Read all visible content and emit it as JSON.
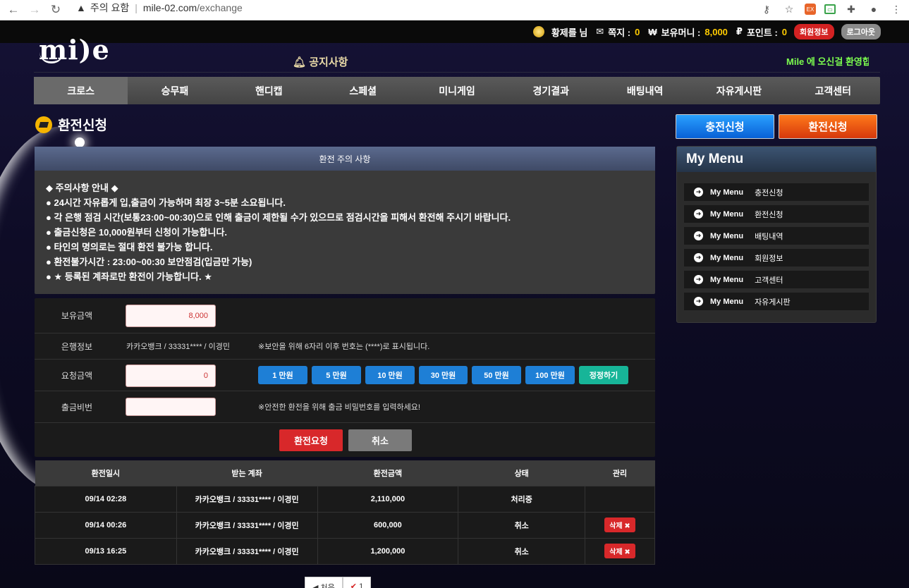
{
  "browser": {
    "warning_label": "주의 요함",
    "url_host": "mile-02.com",
    "url_path": "/exchange"
  },
  "topbar": {
    "user": "황제를 님",
    "messages_label": "쪽지 :",
    "messages_count": "0",
    "money_label": "보유머니 :",
    "money_value": "8,000",
    "points_label": "포인트 :",
    "points_value": "0",
    "member_info_button": "회원정보",
    "logout_button": "로그아웃"
  },
  "header": {
    "logo_text": "mi)e",
    "notice_title": "공지사항",
    "ticker_text": "Mile 에 오신걸 환영합니다"
  },
  "nav": {
    "items": [
      "크로스",
      "승무패",
      "핸디캡",
      "스페셜",
      "미니게임",
      "경기결과",
      "배팅내역",
      "자유게시판",
      "고객센터"
    ]
  },
  "page": {
    "title": "환전신청"
  },
  "notice_box": {
    "header": "환전 주의 사항",
    "heading": "◆ 주의사항 안내 ◆",
    "lines": [
      "●  24시간 자유롭게 입,출금이 가능하며 최장 3~5분 소요됩니다.",
      "●  각 은행 점검 시간(보통23:00~00:30)으로 인해 출금이 제한될 수가 있으므로 점검시간을 피해서 환전해 주시기 바랍니다.",
      "●  출금신청은 10,000원부터 신청이 가능합니다.",
      "●  타인의 명의로는 절대 환전 불가능 합니다.",
      "●  환전불가시간 : 23:00~00:30 보안점검(입금만 가능)",
      "●  ★ 등록된 계좌로만 환전이 가능합니다. ★"
    ]
  },
  "form": {
    "balance_label": "보유금액",
    "balance_value": "8,000",
    "bank_label": "은행정보",
    "bank_value": "카카오뱅크 / 33331**** / 이경민",
    "bank_note": "※보안을 위해 6자리 이후 번호는 (****)로 표시됩니다.",
    "request_label": "요청금액",
    "request_value": "0",
    "amount_buttons": [
      "1 만원",
      "5 만원",
      "10 만원",
      "30 만원",
      "50 만원",
      "100 만원"
    ],
    "reset_button": "정정하기",
    "password_label": "출금비번",
    "password_note": "※안전한 환전을 위해 출금 비밀번호를 입력하세요!",
    "submit_button": "환전요청",
    "cancel_button": "취소"
  },
  "history": {
    "columns": [
      "환전일시",
      "받는 계좌",
      "환전금액",
      "상태",
      "관리"
    ],
    "rows": [
      {
        "date": "09/14 02:28",
        "account": "카카오뱅크 / 33331**** / 이경민",
        "amount": "2,110,000",
        "status": "처리중",
        "action": ""
      },
      {
        "date": "09/14 00:26",
        "account": "카카오뱅크 / 33331**** / 이경민",
        "amount": "600,000",
        "status": "취소",
        "action": "삭제 ✖"
      },
      {
        "date": "09/13 16:25",
        "account": "카카오뱅크 / 33331**** / 이경민",
        "amount": "1,200,000",
        "status": "취소",
        "action": "삭제 ✖"
      }
    ],
    "pager_first": "처음",
    "pager_page": "1"
  },
  "sidebar": {
    "charge_button": "충전신청",
    "exchange_button": "환전신청",
    "menu_title": "My Menu",
    "menu_prefix": "My Menu",
    "menu_items": [
      "충전신청",
      "환전신청",
      "배팅내역",
      "회원정보",
      "고객센터",
      "자유게시판"
    ]
  }
}
